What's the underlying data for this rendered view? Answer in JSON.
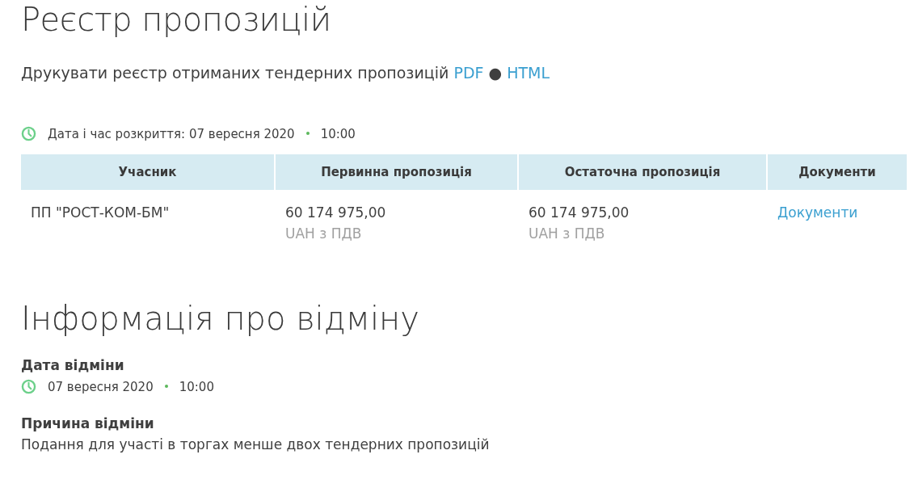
{
  "title": "Реєстр пропозицій",
  "print_line": {
    "text": "Друкувати реєстр отриманих тендерних пропозицій",
    "links": [
      "PDF",
      "HTML"
    ],
    "separator": "●"
  },
  "opening": {
    "label": "Дата і час розкриття: 07 вересня 2020",
    "time": "10:00"
  },
  "table": {
    "columns": [
      "Учасник",
      "Первинна пропозиція",
      "Остаточна пропозиція",
      "Документи"
    ],
    "rows": [
      {
        "participant": "ПП \"РОСТ-КОМ-БМ\"",
        "initial": {
          "amount": "60 174 975,00",
          "currency": "UAH з ПДВ"
        },
        "final": {
          "amount": "60 174 975,00",
          "currency": "UAH з ПДВ"
        },
        "documents": "Документи"
      }
    ]
  },
  "cancellation": {
    "title": "Інформація про відміну",
    "date_heading": "Дата відміни",
    "date": "07 вересня 2020",
    "time": "10:00",
    "reason_heading": "Причина відміни",
    "reason": "Подання для участі в торгах менше двох тендерних пропозицій"
  }
}
